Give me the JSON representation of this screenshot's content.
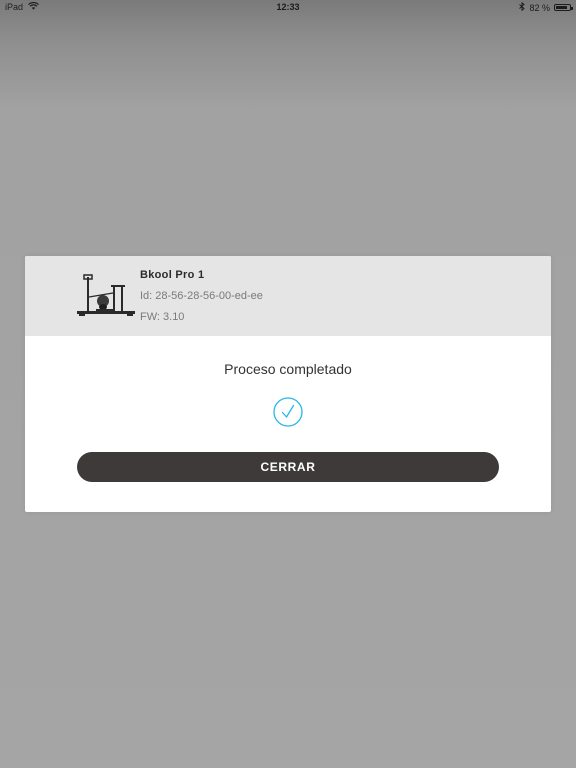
{
  "status_bar": {
    "device": "iPad",
    "time": "12:33",
    "battery_text": "82 %",
    "battery_level": 0.82,
    "icons": [
      "wifi-icon",
      "bluetooth-icon",
      "battery-icon"
    ]
  },
  "dialog": {
    "device": {
      "name": "Bkool Pro 1",
      "id": "Id: 28-56-28-56-00-ed-ee",
      "fw": "FW: 3.10",
      "image": "bike-trainer-image"
    },
    "message": "Proceso completado",
    "status_icon": "check-circle-icon",
    "close_label": "CERRAR"
  },
  "colors": {
    "overlay": "#a5a5a5",
    "header_bg": "#e5e5e5",
    "button_bg": "#3e3a3a",
    "accent": "#29b6e8"
  }
}
